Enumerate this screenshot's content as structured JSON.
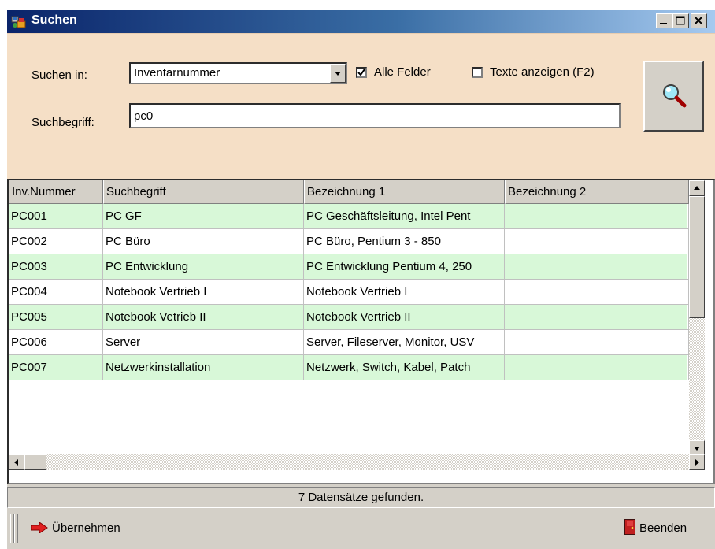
{
  "window": {
    "title": "Suchen",
    "icons": {
      "app": "app-icon",
      "minimize": "minimize-icon",
      "maximize": "maximize-icon",
      "close": "close-icon"
    }
  },
  "search": {
    "search_in_label": "Suchen in:",
    "search_in_value": "Inventarnummer",
    "all_fields_label": "Alle Felder",
    "all_fields_checked": true,
    "show_texts_label": "Texte anzeigen (F2)",
    "show_texts_checked": false,
    "term_label": "Suchbegriff:",
    "term_value": "pc0",
    "search_button_icon": "magnifier-icon"
  },
  "table": {
    "columns": [
      "Inv.Nummer",
      "Suchbegriff",
      "Bezeichnung 1",
      "Bezeichnung 2"
    ],
    "rows": [
      [
        "PC001",
        "PC GF",
        "PC Geschäftsleitung, Intel Pent",
        ""
      ],
      [
        "PC002",
        "PC Büro",
        "PC Büro, Pentium 3 - 850",
        ""
      ],
      [
        "PC003",
        "PC Entwicklung",
        "PC Entwicklung Pentium 4, 250",
        ""
      ],
      [
        "PC004",
        "Notebook Vertrieb I",
        "Notebook Vertrieb I",
        ""
      ],
      [
        "PC005",
        "Notebook Vetrieb II",
        "Notebook Vertrieb II",
        ""
      ],
      [
        "PC006",
        "Server",
        "Server, Fileserver, Monitor, USV",
        ""
      ],
      [
        "PC007",
        "Netzwerkinstallation",
        "Netzwerk, Switch, Kabel, Patch",
        ""
      ]
    ],
    "row_colors": [
      "#d8f8d8",
      "#ffffff"
    ]
  },
  "status": {
    "text": "7 Datensätze gefunden."
  },
  "toolbar": {
    "apply_label": "Übernehmen",
    "apply_icon": "red-arrow-icon",
    "exit_label": "Beenden",
    "exit_icon": "door-icon"
  },
  "colors": {
    "title_bar": "#0a246a",
    "panel": "#f5dfc6",
    "face": "#d4d0c8",
    "row_highlight": "#d8f8d8"
  }
}
